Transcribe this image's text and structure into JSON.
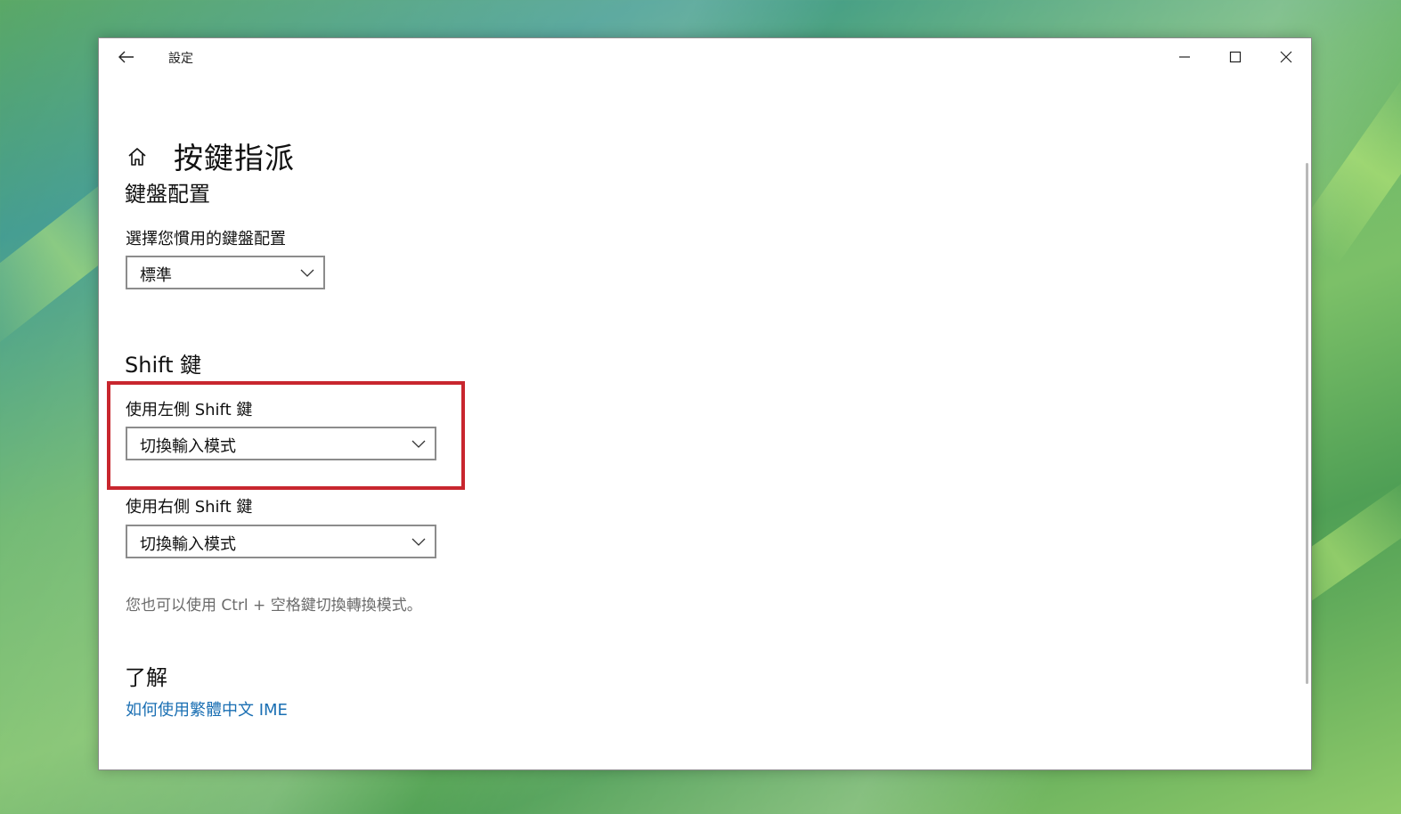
{
  "window": {
    "app_title": "設定",
    "page_title": "按鍵指派"
  },
  "icons": {
    "back": "back-arrow-icon",
    "minimize": "minimize-icon",
    "maximize": "maximize-icon",
    "close": "close-icon",
    "home": "home-icon",
    "dropdown": "chevron-down-icon"
  },
  "keyboard_layout": {
    "heading": "鍵盤配置",
    "label": "選擇您慣用的鍵盤配置",
    "value": "標準"
  },
  "shift": {
    "heading": "Shift 鍵",
    "left_label": "使用左側 Shift 鍵",
    "left_value": "切換輸入模式",
    "right_label": "使用右側 Shift 鍵",
    "right_value": "切換輸入模式",
    "hint": "您也可以使用 Ctrl + 空格鍵切換轉換模式。"
  },
  "learn": {
    "heading": "了解",
    "link": "如何使用繁體中文 IME"
  },
  "colors": {
    "highlight": "#c8262e",
    "link": "#1a6fb3"
  }
}
